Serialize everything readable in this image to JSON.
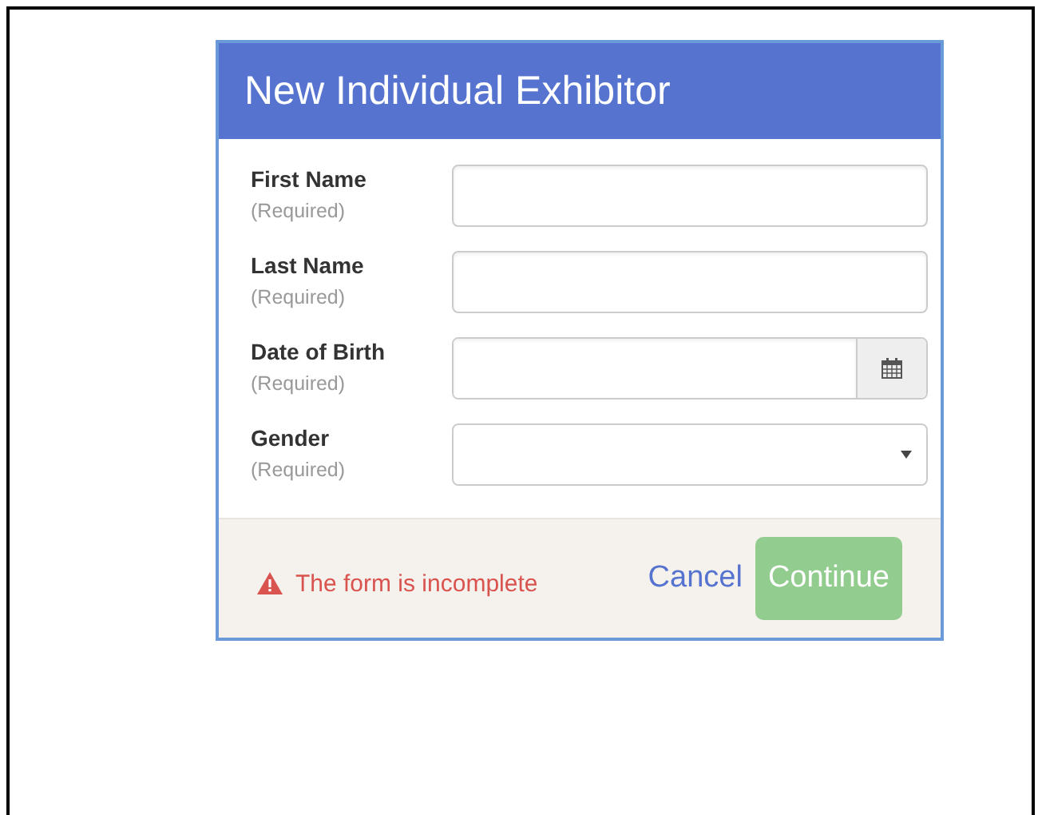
{
  "dialog": {
    "title": "New Individual Exhibitor",
    "fields": [
      {
        "label": "First Name",
        "hint": "(Required)",
        "kind": "text"
      },
      {
        "label": "Last Name",
        "hint": "(Required)",
        "kind": "text"
      },
      {
        "label": "Date of Birth",
        "hint": "(Required)",
        "kind": "date"
      },
      {
        "label": "Gender",
        "hint": "(Required)",
        "kind": "select"
      }
    ],
    "error": "The form is incomplete",
    "cancel": "Cancel",
    "continue": {
      "label": "Continue",
      "disabled": true
    }
  }
}
